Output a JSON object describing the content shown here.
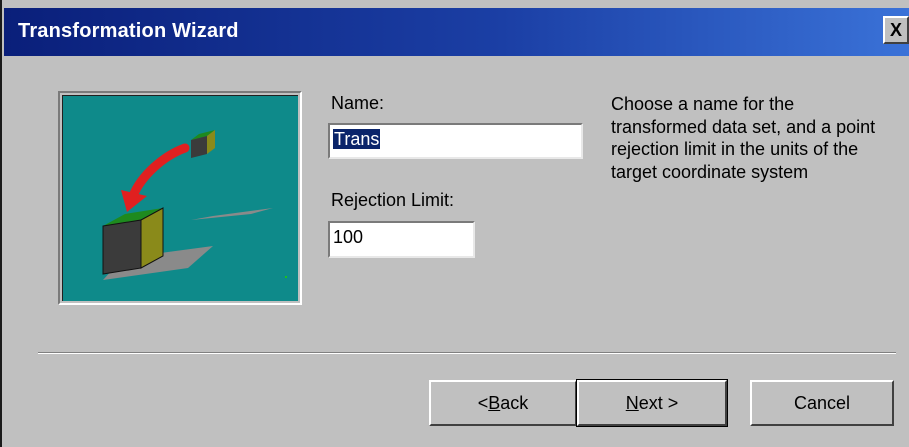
{
  "window": {
    "title": "Transformation Wizard",
    "close_label": "X"
  },
  "illustration": {
    "icon": "transform-cube-illustration"
  },
  "form": {
    "name_label": "Name:",
    "name_value": "Trans",
    "rejection_label": "Rejection Limit:",
    "rejection_value": "100"
  },
  "help": {
    "text": "Choose a name for the transformed data set, and a point rejection limit in the units of the target coordinate system"
  },
  "buttons": {
    "back_prefix": "< ",
    "back_accel": "B",
    "back_rest": "ack",
    "next_accel": "N",
    "next_rest": "ext >",
    "cancel": "Cancel"
  },
  "colors": {
    "titlebar_start": "#0a1f7a",
    "titlebar_end": "#3a72d8",
    "illustration_bg": "#0e8a8a",
    "selection": "#0a246a"
  }
}
